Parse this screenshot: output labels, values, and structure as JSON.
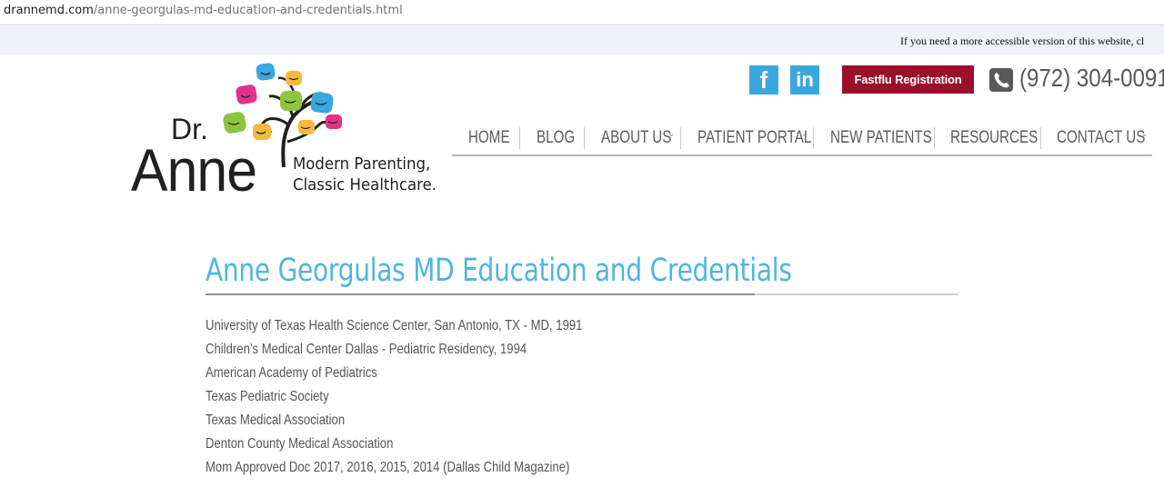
{
  "browser": {
    "url_domain": "drannemd.com",
    "url_path": "/anne-georgulas-md-education-and-credentials.html"
  },
  "accessibility_notice": "If you need a more accessible version of this website, cl",
  "logo": {
    "prefix": "Dr.",
    "name": "Anne",
    "tagline_line1": "Modern Parenting,",
    "tagline_line2": "Classic Healthcare."
  },
  "header": {
    "social": [
      {
        "name": "facebook-icon",
        "glyph": "f"
      },
      {
        "name": "linkedin-icon",
        "glyph": "in"
      }
    ],
    "fastflu_label": "Fastflu Registration",
    "phone": "(972) 304-0091",
    "accent_red": "#9c0f2b",
    "accent_blue": "#3aa7de"
  },
  "nav": {
    "items": [
      {
        "label": "HOME",
        "has_dropdown": false
      },
      {
        "label": "BLOG",
        "has_dropdown": false
      },
      {
        "label": "ABOUT US",
        "has_dropdown": true
      },
      {
        "label": "PATIENT PORTAL",
        "has_dropdown": true
      },
      {
        "label": "NEW PATIENTS",
        "has_dropdown": true
      },
      {
        "label": "RESOURCES",
        "has_dropdown": true
      },
      {
        "label": "CONTACT US",
        "has_dropdown": true
      }
    ]
  },
  "main": {
    "title": "Anne Georgulas MD Education and Credentials",
    "title_color": "#4fb6e0",
    "credentials": [
      "University of Texas Health Science Center, San Antonio, TX - MD, 1991",
      "Children’s Medical Center Dallas - Pediatric Residency, 1994",
      "American Academy of Pediatrics",
      "Texas Pediatric Society",
      "Texas Medical Association",
      "Denton County Medical Association",
      "Mom Approved Doc 2017, 2016, 2015, 2014 (Dallas Child Magazine)"
    ]
  }
}
